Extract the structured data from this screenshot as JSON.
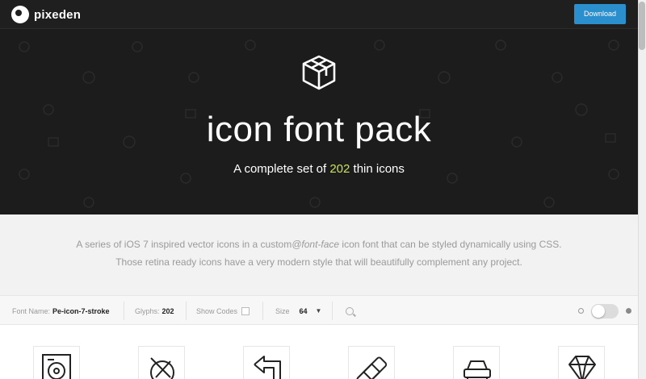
{
  "nav": {
    "brand": "pixeden",
    "download_label": "Download",
    "brand_color": "#2b8fce"
  },
  "hero": {
    "title": "icon font pack",
    "subtitle_pre": "A complete set of ",
    "subtitle_count": "202",
    "subtitle_post": " thin icons",
    "highlight_color": "#c7e15e"
  },
  "description": {
    "line1_pre": "A series of iOS 7 inspired vector icons in a custom",
    "line1_em": "@font-face",
    "line1_post": " icon font that can be styled dynamically using CSS.",
    "line2": "Those retina ready icons have a very modern style that will beautifully complement any project."
  },
  "toolbar": {
    "font_name_label": "Font Name:",
    "font_name_value": "Pe-icon-7-stroke",
    "glyphs_label": "Glyphs:",
    "glyphs_value": "202",
    "show_codes_label": "Show Codes",
    "size_label": "Size",
    "size_value": "64",
    "icons": {
      "size_caret": "caret-down-icon",
      "search": "search-icon",
      "theme_light": "light-theme-dot-icon",
      "theme_dark": "dark-theme-dot-icon"
    }
  },
  "icons": [
    "disc-icon",
    "compass-icon",
    "back-arrow-icon",
    "bandage-icon",
    "car-icon",
    "diamond-icon"
  ]
}
